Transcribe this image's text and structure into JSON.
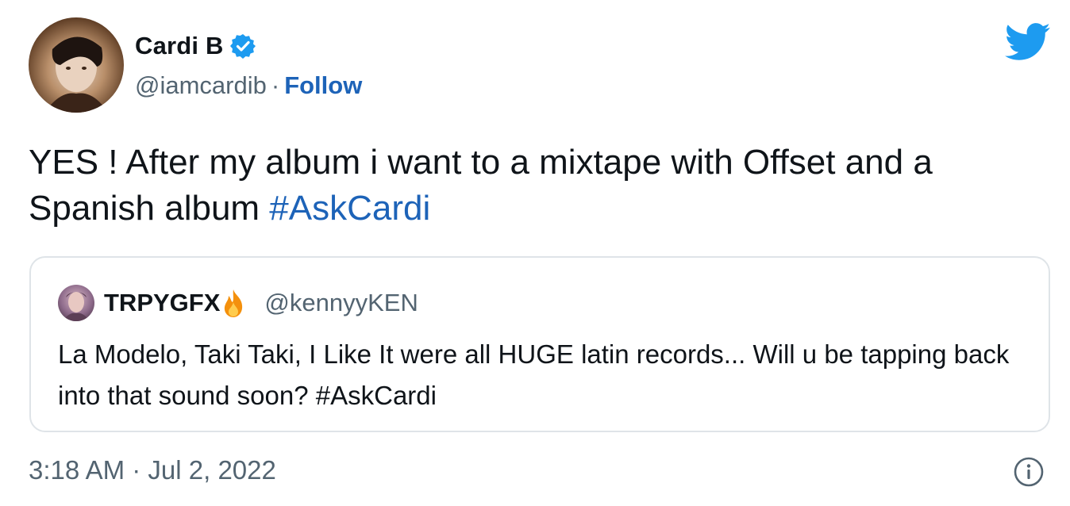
{
  "author": {
    "display_name": "Cardi B",
    "handle": "@iamcardib",
    "separator": "·",
    "follow_label": "Follow",
    "verified": true
  },
  "tweet": {
    "text": "YES ! After my album i want to a mixtape with Offset and a Spanish album ",
    "hashtag": "#AskCardi"
  },
  "quoted_tweet": {
    "display_name": "TRPYGFX",
    "handle": "@kennyyKEN",
    "emoji": "fire-icon",
    "text": "La Modelo, Taki Taki, I Like It were all HUGE latin records... Will u be tapping back into that sound soon? ",
    "hashtag": "#AskCardi"
  },
  "footer": {
    "timestamp": "3:18 AM · Jul 2, 2022",
    "info_icon": "info-icon"
  },
  "colors": {
    "link": "#1d63b8",
    "twitter_blue": "#1d9bf0",
    "muted": "#536471",
    "text": "#0f1419",
    "border": "#dfe4e8"
  }
}
